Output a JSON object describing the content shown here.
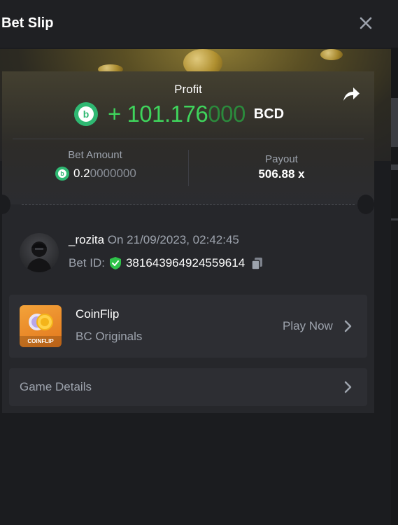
{
  "header": {
    "title": "Bet Slip"
  },
  "profit": {
    "label": "Profit",
    "value_main": "+ 101.176",
    "value_trail": "000",
    "currency": "BCD"
  },
  "bet": {
    "amount_label": "Bet Amount",
    "amount_main": "0.2",
    "amount_trail": "0000000",
    "payout_label": "Payout",
    "payout_value": "506.88 x"
  },
  "user": {
    "name": "_rozita",
    "date_text": " On 21/09/2023, 02:42:45",
    "bet_id_label": "Bet ID:",
    "bet_id": "381643964924559614"
  },
  "game": {
    "name": "CoinFlip",
    "provider": "BC Originals",
    "play_label": "Play Now",
    "thumb_text": "COINFLIP"
  },
  "details": {
    "label": "Game Details"
  },
  "icons": {
    "close": "close-icon",
    "share": "share-icon",
    "coin": "bc-coin-icon",
    "verified": "shield-check-icon",
    "copy": "copy-icon",
    "chevron": "chevron-right-icon"
  },
  "colors": {
    "accent_green": "#3fd45c",
    "coin_green": "#2fb872",
    "background": "#1b1c1f",
    "card": "#26272b"
  }
}
